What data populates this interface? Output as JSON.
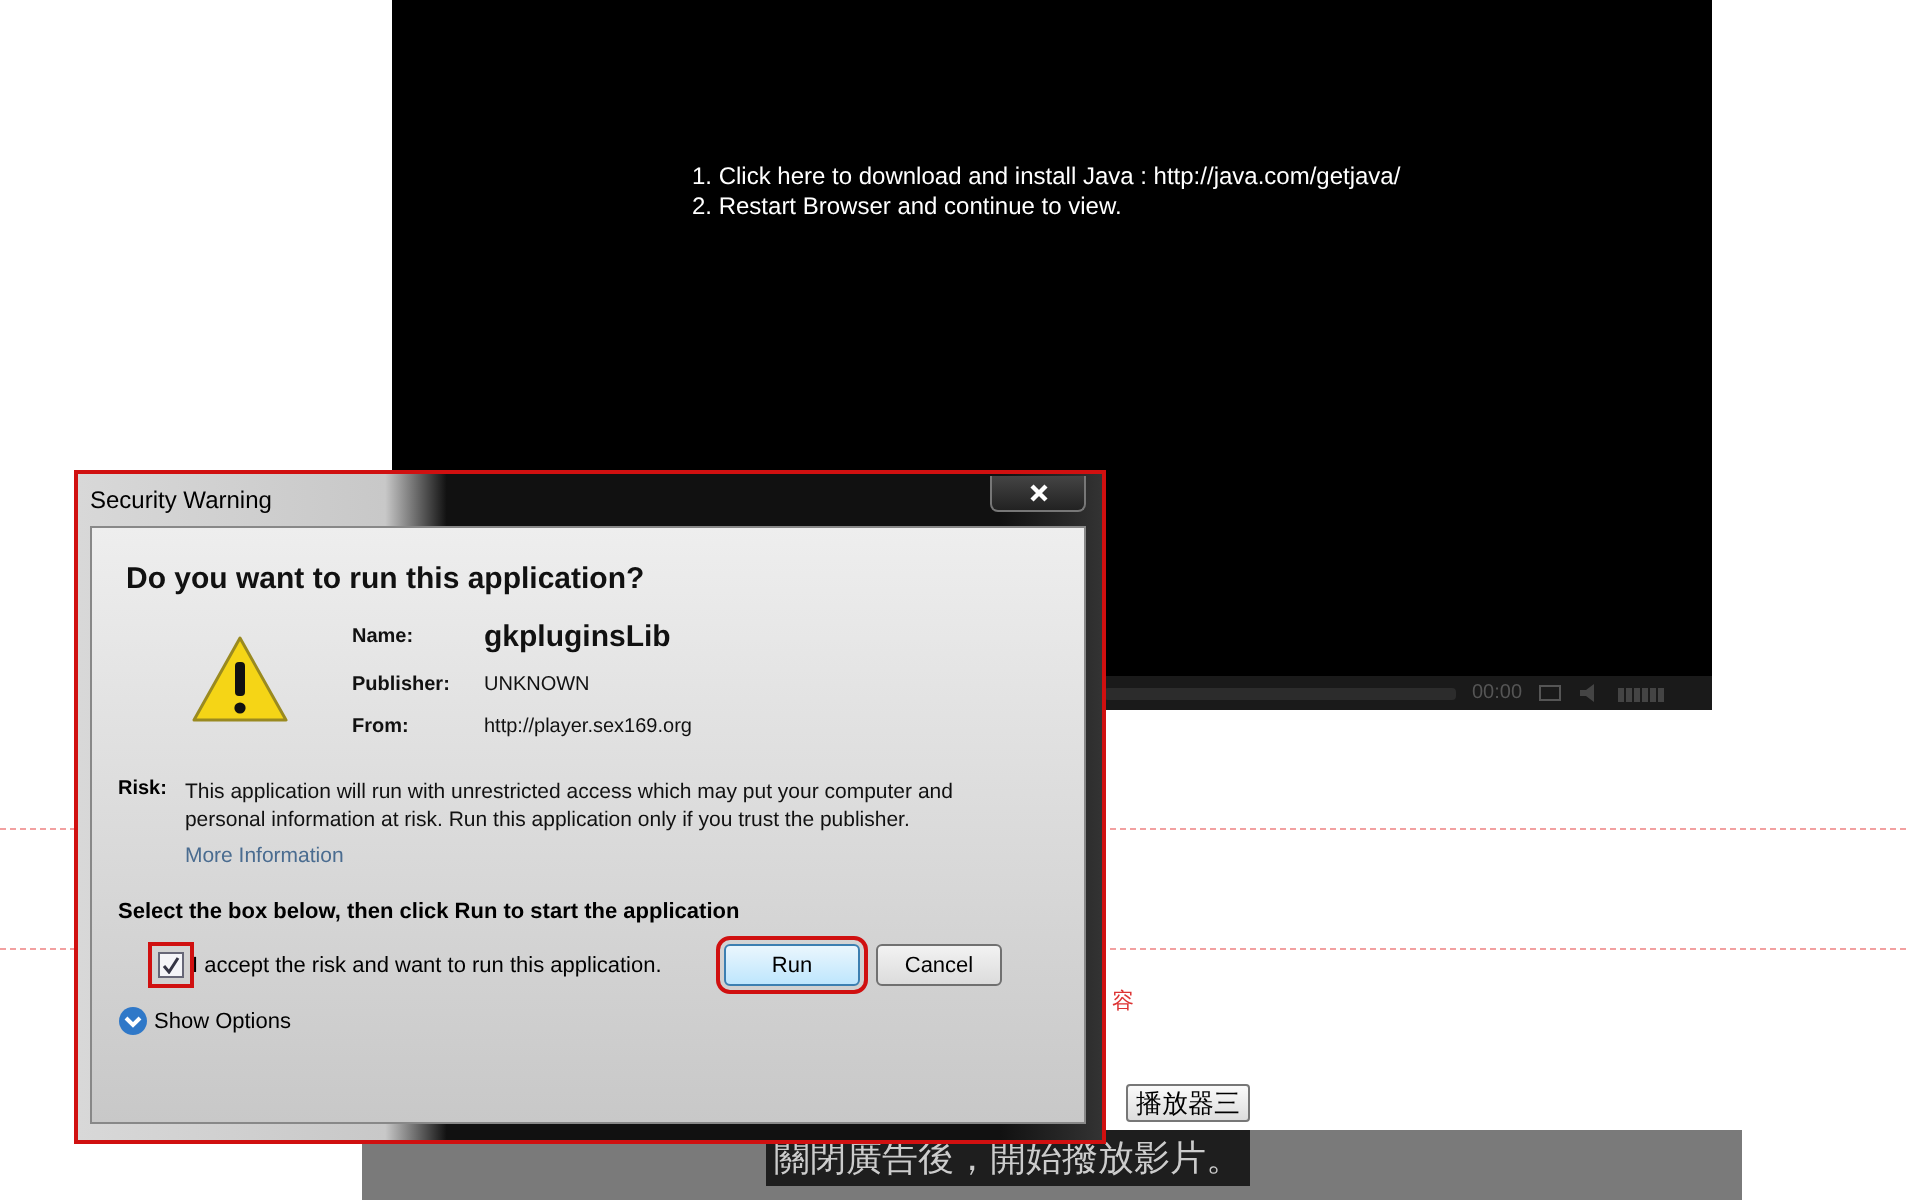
{
  "player": {
    "message_lines": [
      "1. Click here to download and install Java : http://java.com/getjava/",
      "2. Restart Browser and continue to view."
    ],
    "time": "00:00"
  },
  "page": {
    "side_text": "容",
    "buttons": [
      "播放器三"
    ],
    "caption": "關閉廣告後，開始撥放影片。"
  },
  "dialog": {
    "title": "Security Warning",
    "heading": "Do you want to run this application?",
    "fields": [
      {
        "label": "Name:",
        "value": "gkpluginsLib",
        "kind": "large"
      },
      {
        "label": "Publisher:",
        "value": "UNKNOWN",
        "kind": "normal"
      },
      {
        "label": "From:",
        "value": "http://player.sex169.org",
        "kind": "normal"
      }
    ],
    "risk_label": "Risk:",
    "risk_text": "This application will run with unrestricted access which may put your computer and personal information at risk. Run this application only if you trust the publisher.",
    "more_info": "More Information",
    "instruction": "Select the box below, then click Run to start the application",
    "accept": {
      "label": "I accept the risk and want to run this application.",
      "checked": true
    },
    "buttons": [
      {
        "label": "Run",
        "default": true
      },
      {
        "label": "Cancel",
        "default": false
      }
    ],
    "show_options": "Show Options"
  }
}
